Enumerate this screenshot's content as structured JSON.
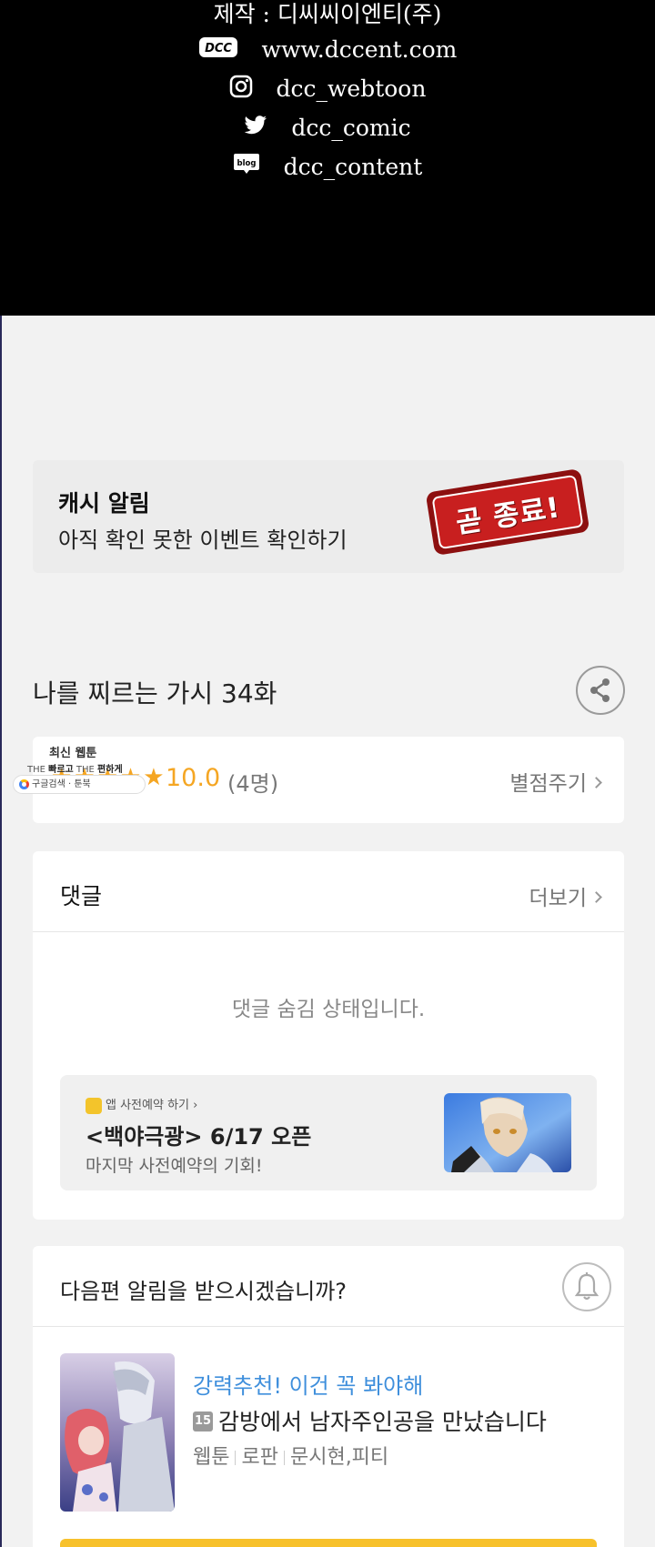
{
  "credits": {
    "producer": "제작 : 디씨씨이엔티(주)",
    "website": "www.dccent.com",
    "instagram": "dcc_webtoon",
    "twitter": "dcc_comic",
    "blog": "dcc_content",
    "blog_icon_text": "blog",
    "logo_text": "DCC"
  },
  "banner": {
    "title": "캐시 알림",
    "subtitle": "아직 확인 못한 이벤트 확인하기",
    "stamp_text": "곧 종료!"
  },
  "episode": {
    "title": "나를 찌르는 가시 34화",
    "share_icon": "share-icon"
  },
  "rating": {
    "stars": "★★★★★",
    "score": "10.0",
    "count": "(4명)",
    "rate_link": "별점주기"
  },
  "ad_widget": {
    "top": "최신 웹툰",
    "line_prefix1": "THE ",
    "line_bold1": "빠르고",
    "line_prefix2": " THE ",
    "line_bold2": "편하게",
    "pill_text": "구글검색 · 툰북"
  },
  "comments": {
    "title": "댓글",
    "more": "더보기",
    "hidden_msg": "댓글 숨김 상태입니다."
  },
  "promo": {
    "tag": "앱 사전예약 하기 ›",
    "title": "<백야극광> 6/17 오픈",
    "subtitle": "마지막 사전예약의 기회!"
  },
  "notify": {
    "title": "다음편 알림을 받으시겠습니까?",
    "bell_icon": "bell-icon"
  },
  "recommend": {
    "headline": "강력추천! 이건 꼭 봐야해",
    "age": "15",
    "title": "감방에서 남자주인공을 만났습니다",
    "genre": "웹툰",
    "subgenre": "로판",
    "authors": "문시현,피티"
  },
  "colors": {
    "accent_star": "#f5a623",
    "accent_blue": "#3f8fdc",
    "stamp_red": "#c81f1f",
    "cta_yellow": "#f7c12c"
  }
}
